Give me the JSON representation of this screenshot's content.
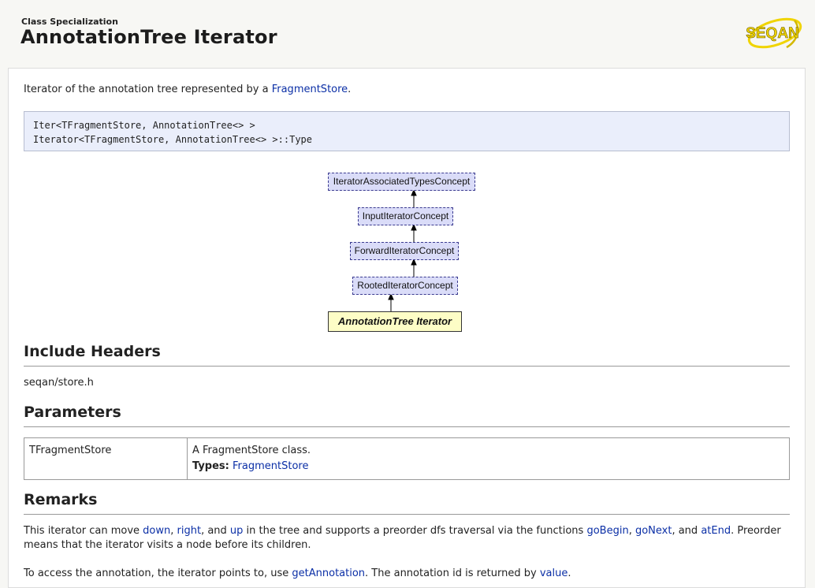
{
  "header": {
    "kind": "Class Specialization",
    "title": "AnnotationTree Iterator",
    "logo_text": "SEQAN"
  },
  "intro": {
    "prefix": "Iterator of the annotation tree represented by a ",
    "link": "FragmentStore",
    "suffix": "."
  },
  "signature": [
    "Iter<TFragmentStore, AnnotationTree<> >",
    "Iterator<TFragmentStore, AnnotationTree<> >::Type"
  ],
  "diagram": {
    "nodes": [
      "IteratorAssociatedTypesConcept",
      "InputIteratorConcept",
      "ForwardIteratorConcept",
      "RootedIteratorConcept",
      "AnnotationTree Iterator"
    ]
  },
  "include": {
    "heading": "Include Headers",
    "header_file": "seqan/store.h"
  },
  "parameters": {
    "heading": "Parameters",
    "rows": [
      {
        "name": "TFragmentStore",
        "desc": "A FragmentStore class.",
        "types_label": "Types:",
        "types_link": "FragmentStore"
      }
    ]
  },
  "remarks": {
    "heading": "Remarks",
    "p1": {
      "t1": "This iterator can move ",
      "down": "down",
      "t2": ", ",
      "right": "right",
      "t3": ", and ",
      "up": "up",
      "t4": " in the tree and supports a preorder dfs traversal via the functions ",
      "goBegin": "goBegin",
      "t5": ", ",
      "goNext": "goNext",
      "t6": ", and ",
      "atEnd": "atEnd",
      "t7": ". Preorder",
      "line2": "means that the iterator visits a node before its children."
    },
    "p2": {
      "t1": "To access the annotation, the iterator points to, use ",
      "getAnnotation": "getAnnotation",
      "t2": ". The annotation id is returned by ",
      "value": "value",
      "t3": "."
    }
  },
  "colors": {
    "link": "#0b2fa6",
    "concept_fill": "#dadcf8",
    "current_fill": "#fdfdc6",
    "logo_yellow": "#f0d400"
  }
}
